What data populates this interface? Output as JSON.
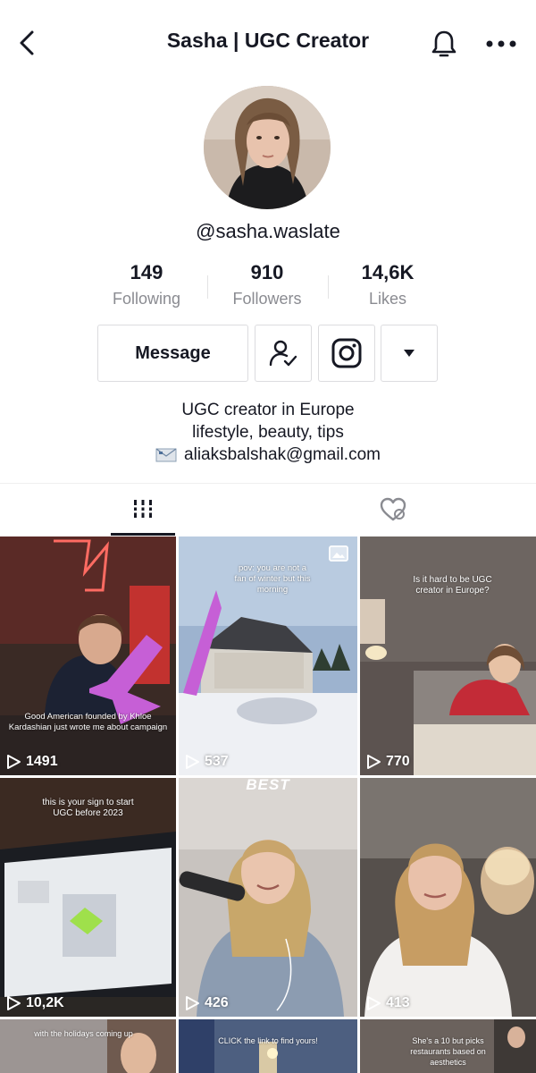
{
  "header": {
    "title": "Sasha | UGC Creator",
    "icons": [
      "chevron-left-icon",
      "bell-icon",
      "more-horizontal-icon"
    ]
  },
  "profile": {
    "handle": "@sasha.waslate",
    "stats": [
      {
        "value": "149",
        "label": "Following"
      },
      {
        "value": "910",
        "label": "Followers"
      },
      {
        "value": "14,6K",
        "label": "Likes"
      }
    ],
    "buttons": {
      "message": "Message"
    },
    "bio": {
      "line1": "UGC creator in Europe",
      "line2": "lifestyle, beauty, tips",
      "email": "aliaksbalshak@gmail.com"
    }
  },
  "tabs": [
    "videos-grid-icon",
    "liked-videos-icon"
  ],
  "videos": [
    {
      "caption": "Good American founded by Khloe Kardashian just wrote me about campaign",
      "views": "1491"
    },
    {
      "caption": "pov: you are not a fan of winter but this morning",
      "views": "537"
    },
    {
      "caption": "Is it hard to be UGC creator in Europe?",
      "views": "770"
    },
    {
      "caption": "this is your sign to start UGC before 2023",
      "views": "10,2K"
    },
    {
      "caption": "BEST",
      "views": "426"
    },
    {
      "caption": "",
      "views": "413"
    },
    {
      "caption": "with the holidays coming up",
      "views": ""
    },
    {
      "caption": "CLICK the link to find yours!",
      "views": ""
    },
    {
      "caption": "She's a 10 but picks restaurants based on aesthetics",
      "views": ""
    }
  ],
  "colors": {
    "text": "#161823",
    "muted": "#8a8b91",
    "border": "#dcdcdf",
    "arrow": "#c65fd6"
  }
}
